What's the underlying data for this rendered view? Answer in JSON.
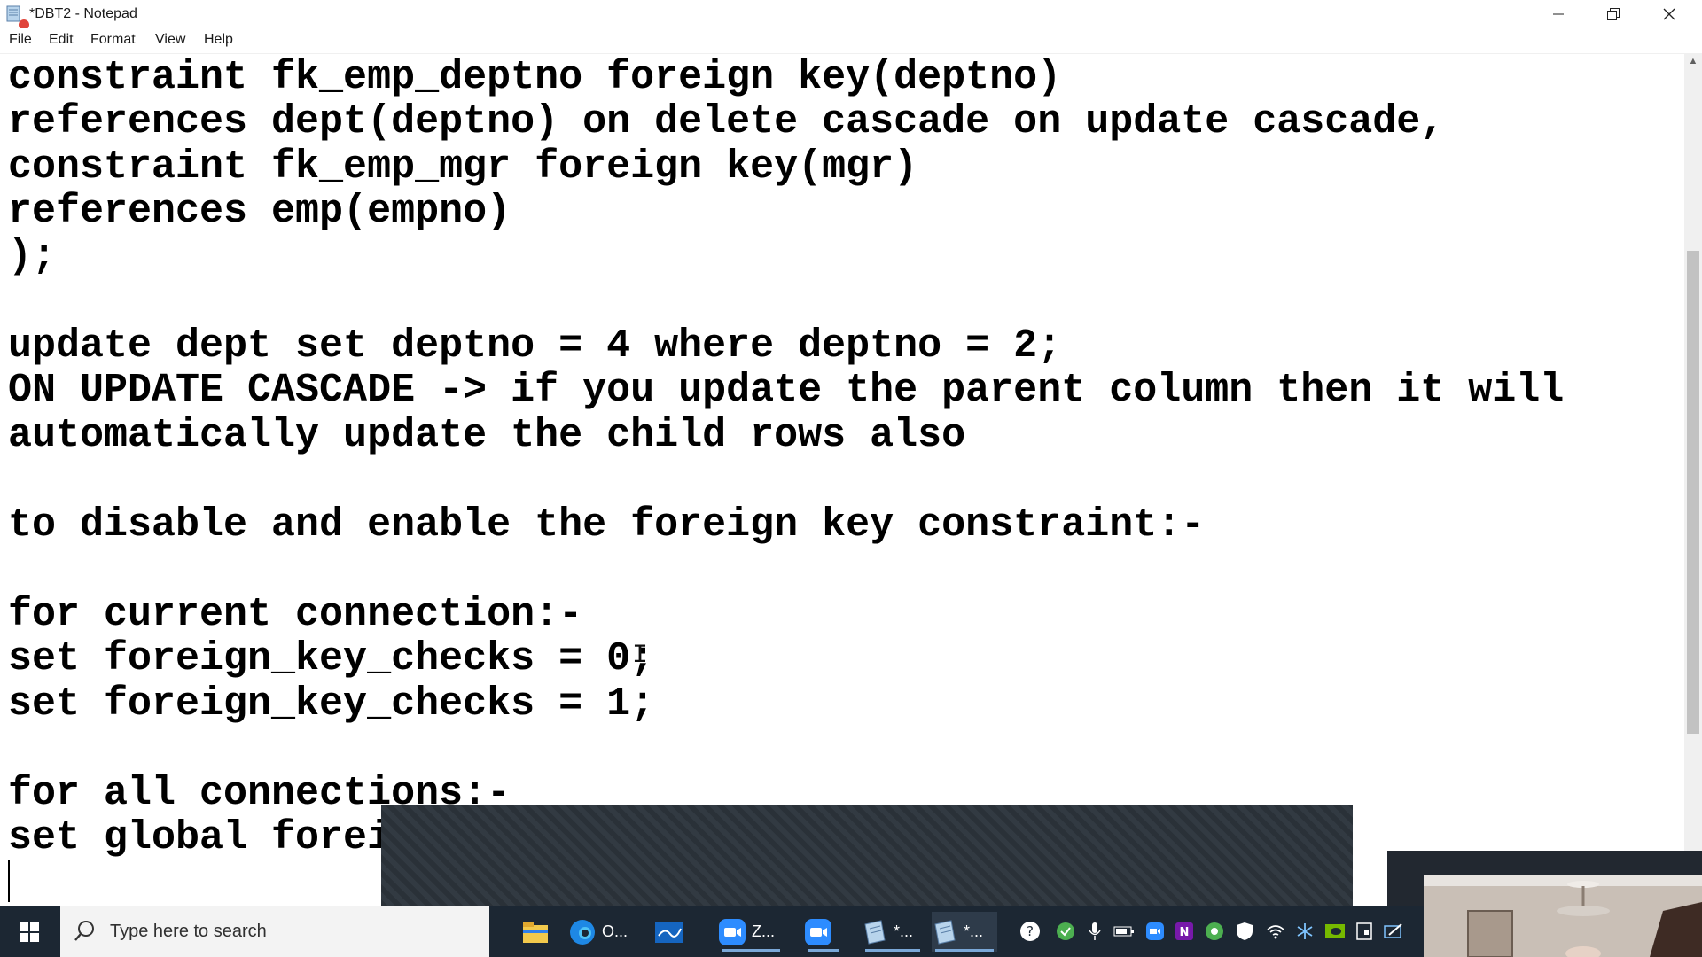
{
  "window": {
    "title": "*DBT2 - Notepad"
  },
  "menu": [
    "File",
    "Edit",
    "Format",
    "View",
    "Help"
  ],
  "editor_lines": [
    "constraint fk_emp_deptno foreign key(deptno)",
    "references dept(deptno) on delete cascade on update cascade,",
    "constraint fk_emp_mgr foreign key(mgr)",
    "references emp(empno)",
    ");",
    "",
    "update dept set deptno = 4 where deptno = 2;",
    "ON UPDATE CASCADE -> if you update the parent column then it will",
    "automatically update the child rows also",
    "",
    "to disable and enable the foreign key constraint:-",
    "",
    "for current connection:-",
    "set foreign_key_checks = 0;",
    "set foreign_key_checks = 1;",
    "",
    "for all connections:-",
    "set global forei"
  ],
  "taskbar": {
    "search_placeholder": "Type here to search",
    "apps": [
      {
        "icon": "file-explorer-icon",
        "label": ""
      },
      {
        "icon": "edge-icon",
        "label": "O..."
      },
      {
        "icon": "whiteboard-icon",
        "label": ""
      },
      {
        "icon": "zoom-icon",
        "label": "Z..."
      },
      {
        "icon": "zoom-meeting-icon",
        "label": ""
      },
      {
        "icon": "notepad-icon",
        "label": "*..."
      },
      {
        "icon": "notepad-icon",
        "label": "*..."
      }
    ]
  },
  "colors": {
    "taskbar_bg": "#1c2733",
    "accent": "#7aa8d8"
  }
}
